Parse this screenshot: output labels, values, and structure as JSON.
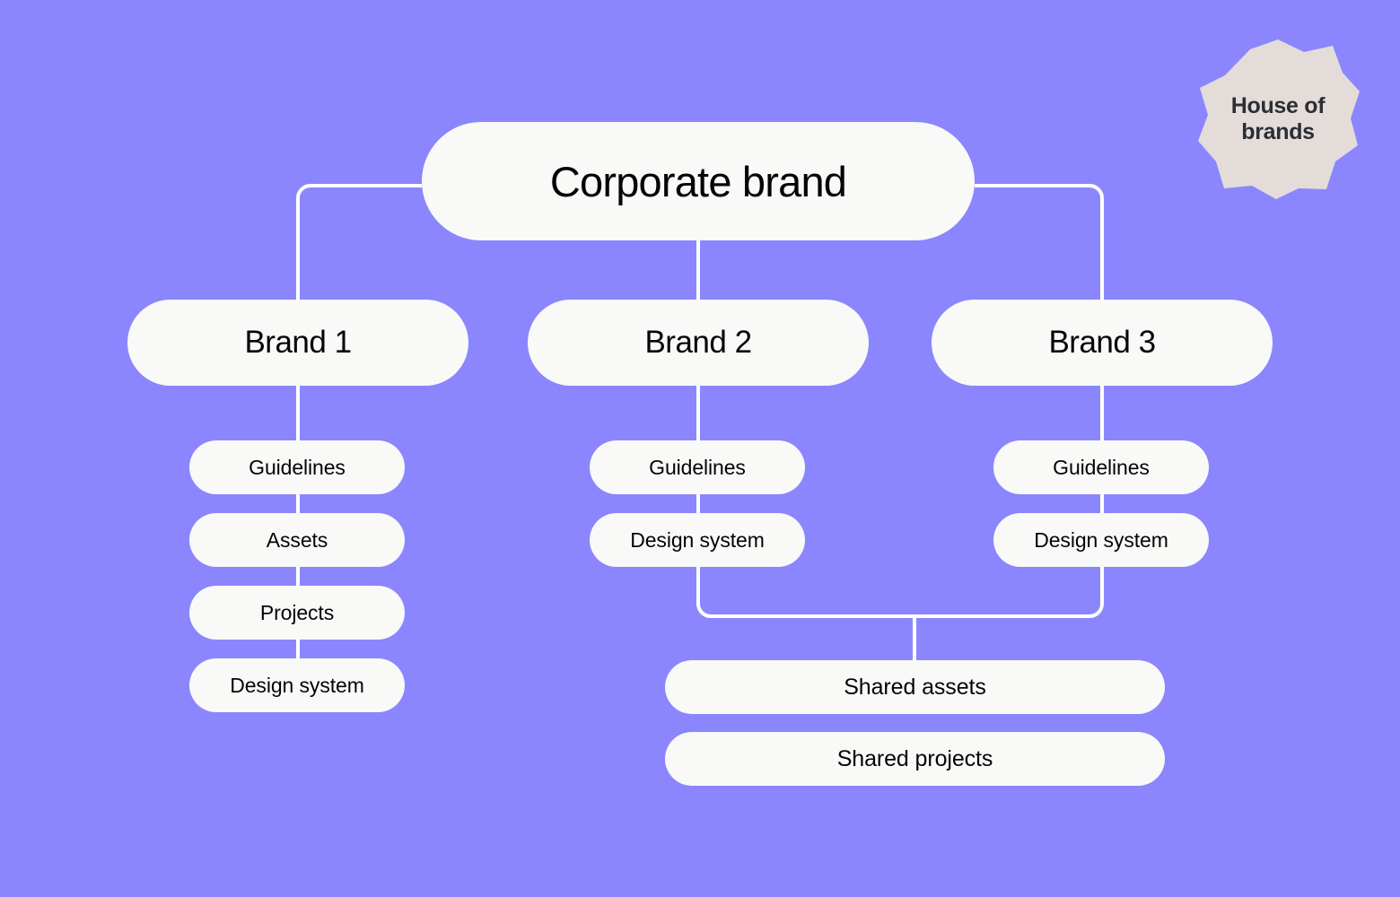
{
  "canvas": {
    "background_color": "#8b86fd",
    "node_fill_color": "#f9f9f8",
    "node_text_color": "#050505",
    "connector_color": "#ffffff"
  },
  "badge": {
    "name": "house-of-brands-badge",
    "line1": "House of",
    "line2": "brands",
    "fill_color": "#e4dcd9",
    "text_color": "#2b2f33"
  },
  "diagram": {
    "type": "hierarchy",
    "root": {
      "label": "Corporate brand"
    },
    "branches": [
      {
        "label": "Brand 1",
        "children": [
          {
            "label": "Guidelines"
          },
          {
            "label": "Assets"
          },
          {
            "label": "Projects"
          },
          {
            "label": "Design system"
          }
        ]
      },
      {
        "label": "Brand 2",
        "children": [
          {
            "label": "Guidelines"
          },
          {
            "label": "Design system"
          }
        ]
      },
      {
        "label": "Brand 3",
        "children": [
          {
            "label": "Guidelines"
          },
          {
            "label": "Design system"
          }
        ]
      }
    ],
    "shared": [
      {
        "label": "Shared assets"
      },
      {
        "label": "Shared projects"
      }
    ]
  }
}
